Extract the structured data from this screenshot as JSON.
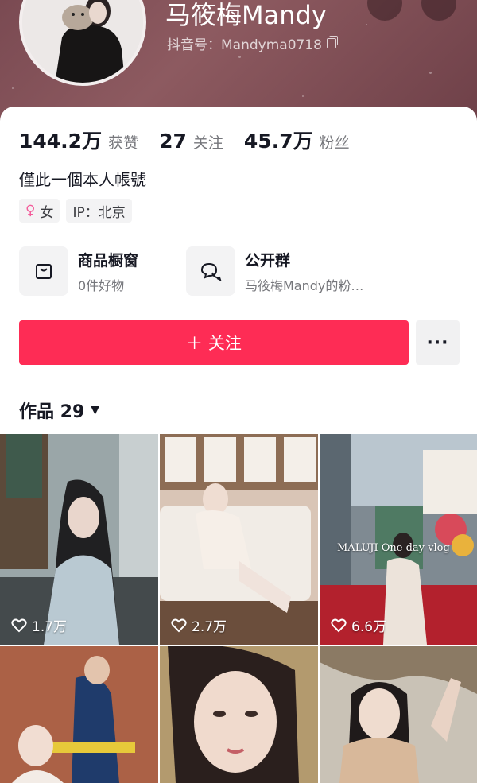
{
  "profile": {
    "name": "马筱梅Mandy",
    "douyin_id": "抖音号：Mandyma0718",
    "bio": "僅此一個本人帳號"
  },
  "stats": [
    {
      "value": "144.2万",
      "label": "获赞"
    },
    {
      "value": "27",
      "label": "关注"
    },
    {
      "value": "45.7万",
      "label": "粉丝"
    }
  ],
  "tags": {
    "gender": "女",
    "ip": "IP：北京"
  },
  "shop": {
    "title": "商品橱窗",
    "subtitle": "0件好物"
  },
  "group": {
    "title": "公开群",
    "subtitle": "马筱梅Mandy的粉…"
  },
  "actions": {
    "follow_label": "＋ 关注",
    "more_label": "···"
  },
  "works": {
    "label": "作品 29"
  },
  "videos": [
    {
      "likes": "1.7万"
    },
    {
      "likes": "2.7万"
    },
    {
      "likes": "6.6万",
      "overlay_text": "MALUJI  One day vlog"
    },
    {},
    {},
    {}
  ],
  "colors": {
    "accent": "#fe2c55",
    "header": "#7a4a52"
  }
}
